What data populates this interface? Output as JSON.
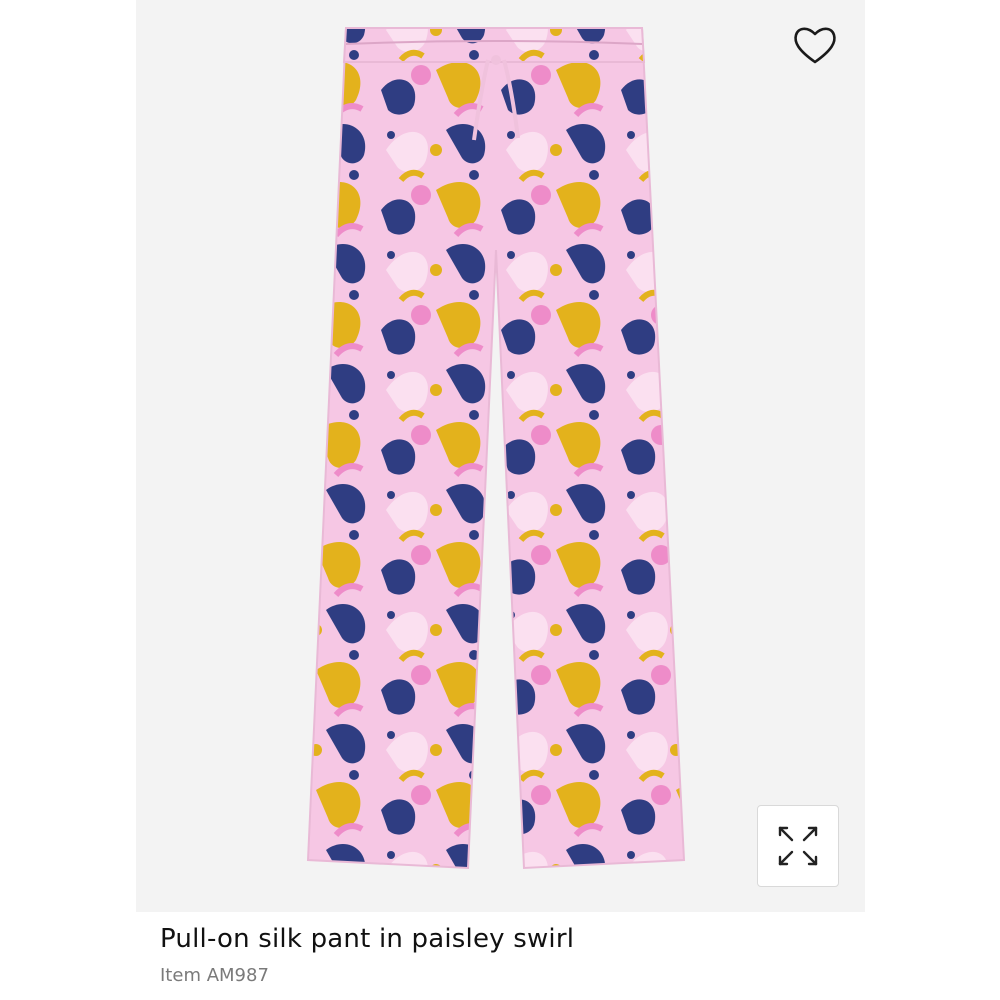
{
  "product": {
    "title": "Pull-on silk pant in paisley swirl",
    "item_number": "Item AM987"
  },
  "actions": {
    "wishlist_icon": "heart-outline-icon",
    "expand_icon": "expand-arrows-icon"
  },
  "colors": {
    "panel_background": "#f3f3f3",
    "fabric_pink": "#f6c7e4",
    "fabric_light_pink": "#fbe0f0",
    "fabric_hot_pink": "#ee8cc9",
    "fabric_yellow": "#e3b21c",
    "fabric_navy": "#2f3d82",
    "title_text": "#111111",
    "subtitle_text": "#7a7a7a"
  }
}
